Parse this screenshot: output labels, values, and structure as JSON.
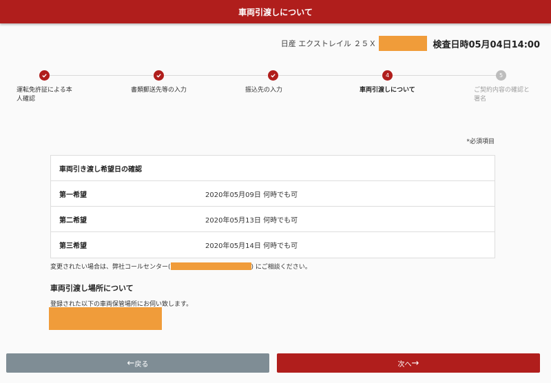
{
  "header": {
    "title": "車両引渡しについて"
  },
  "car": {
    "name": "日産 エクストレイル ２５Ｘ",
    "inspection": "検査日時05月04日14:00"
  },
  "steps": [
    {
      "num": "1",
      "label": "運転免許証による本人確認",
      "state": "done"
    },
    {
      "num": "2",
      "label": "書類郵送先等の入力",
      "state": "done"
    },
    {
      "num": "3",
      "label": "振込先の入力",
      "state": "done"
    },
    {
      "num": "4",
      "label": "車両引渡しについて",
      "state": "current"
    },
    {
      "num": "5",
      "label": "ご契約内容の確認と署名",
      "state": "future"
    }
  ],
  "required_note": "*必須項目",
  "delivery_dates": {
    "title": "車両引き渡し希望日の確認",
    "rows": [
      {
        "label": "第一希望",
        "value": "2020年05月09日 何時でも可"
      },
      {
        "label": "第二希望",
        "value": "2020年05月13日 何時でも可"
      },
      {
        "label": "第三希望",
        "value": "2020年05月14日 何時でも可"
      }
    ]
  },
  "notice": {
    "before": "変更されたい場合は、弊社コールセンター(",
    "after": ") にご相談ください。"
  },
  "location": {
    "title": "車両引渡し場所について",
    "desc": "登録された以下の車両保管場所にお伺い致します。"
  },
  "buttons": {
    "back": "戻る",
    "next": "次へ"
  },
  "colors": {
    "brand": "#b01e1c",
    "back_button": "#7f8d95",
    "redaction": "#f09c3a"
  }
}
